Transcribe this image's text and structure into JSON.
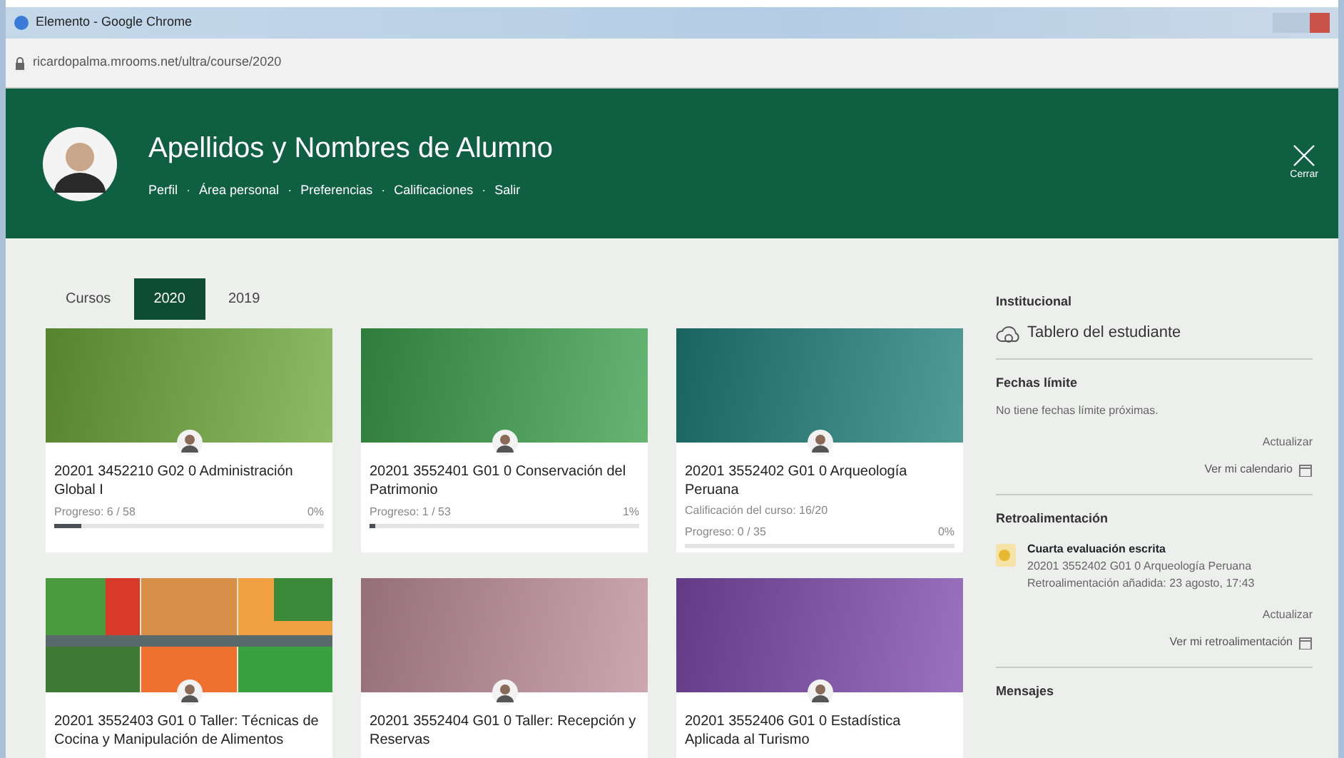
{
  "window": {
    "title": "Elemento - Google Chrome",
    "url": "ricardopalma.mrooms.net/ultra/course/2020"
  },
  "header": {
    "name": "Apellidos y Nombres de Alumno",
    "links": [
      "Perfil",
      "Área personal",
      "Preferencias",
      "Calificaciones",
      "Salir"
    ],
    "separator": "·",
    "close": "Cerrar"
  },
  "tabs": [
    {
      "label": "Cursos",
      "selected": false
    },
    {
      "label": "2020",
      "selected": true
    },
    {
      "label": "2019",
      "selected": false
    }
  ],
  "courses": [
    {
      "title": "20201 3452210 G02 0 Administración Global I",
      "banner": {
        "kind": "gradient",
        "color": "#6fa83a"
      },
      "progress": {
        "label": "Progreso: 6 / 58",
        "percent": "0%",
        "level": 0.1
      }
    },
    {
      "title": "20201 3552401 G01 0 Conservación del Patrimonio",
      "banner": {
        "kind": "gradient",
        "color": "#3ca04c"
      },
      "progress": {
        "label": "Progreso: 1 / 53",
        "percent": "1%",
        "level": 0.02
      }
    },
    {
      "title": "20201 3552402 G01 0 Arqueología Peruana",
      "grade": "Calificación del curso: 16/20",
      "banner": {
        "kind": "gradient",
        "color": "#20807a"
      },
      "progress": {
        "label": "Progreso: 0 / 35",
        "percent": "0%",
        "level": 0
      }
    },
    {
      "title": "20201 3552403 G01 0 Taller: Técnicas de Cocina y Manipulación de Alimentos"
    },
    {
      "title": "20201 3552404 G01 0 Taller: Recepción y Reservas",
      "banner": {
        "kind": "gradient",
        "color": "#bf8e9a"
      }
    },
    {
      "title": "20201 3552406 G01 0 Estadística Aplicada al Turismo",
      "banner": {
        "kind": "gradient",
        "color": "#7f4aac"
      }
    }
  ],
  "sidebar": {
    "sections": [
      {
        "heading": "Institucional",
        "link": "Tablero del estudiante"
      },
      {
        "heading": "Fechas límite",
        "text": "No tiene fechas límite próximas.",
        "update": "Actualizar",
        "action": "Ver mi calendario"
      },
      {
        "heading": "Retroalimentación",
        "item": {
          "title": "Cuarta evaluación escrita",
          "course": "20201 3552402 G01 0 Arqueología Peruana",
          "meta": "Retroalimentación añadida: 23 agosto, 17:43"
        },
        "update": "Actualizar",
        "action": "Ver mi retroalimentación"
      },
      {
        "heading": "Mensajes"
      }
    ]
  }
}
